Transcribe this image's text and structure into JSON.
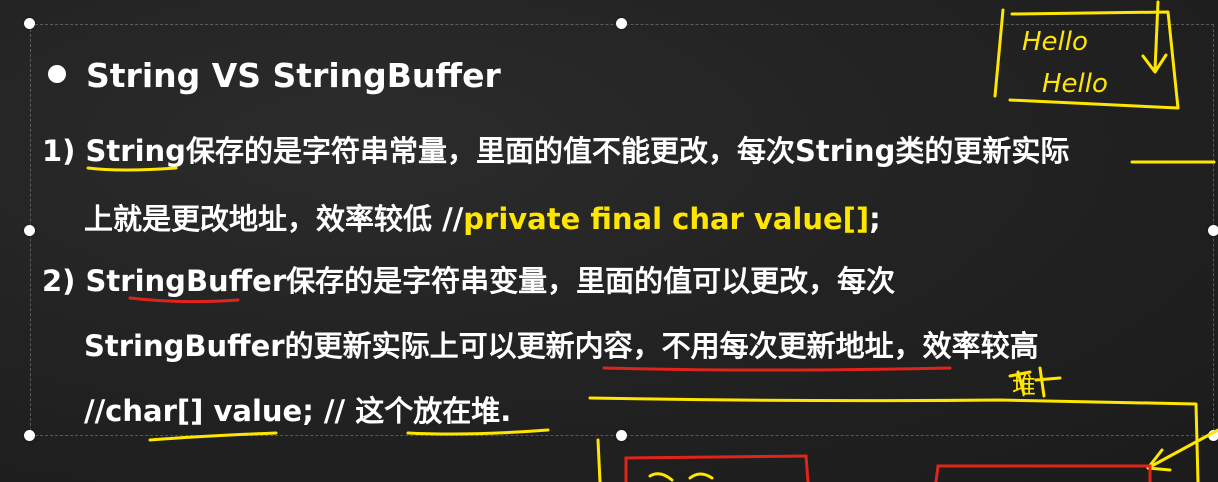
{
  "slide": {
    "title": "String VS StringBuffer",
    "item1": {
      "number": "1)",
      "line1": "String保存的是字符串常量，里面的值不能更改，每次String类的更新实际",
      "line2_prefix": "上就是更改地址，效率较低 //",
      "line2_code": "private final char value[]",
      "line2_suffix": ";"
    },
    "item2": {
      "number": "2)",
      "line1": "StringBuffer保存的是字符串变量，里面的值可以更改，每次",
      "line2": "StringBuffer的更新实际上可以更新内容，不用每次更新地址，效率较高",
      "line3": "//char[] value;   // 这个放在堆."
    }
  },
  "annotations": {
    "note_top_right_1": "Hello",
    "note_top_right_2": "Hello",
    "note_heap": "堆",
    "ink_color_yellow": "#ffe600",
    "ink_color_red": "#e0241b"
  },
  "colors": {
    "background": "#242424",
    "text": "#ffffff",
    "highlight": "#ffe600"
  }
}
